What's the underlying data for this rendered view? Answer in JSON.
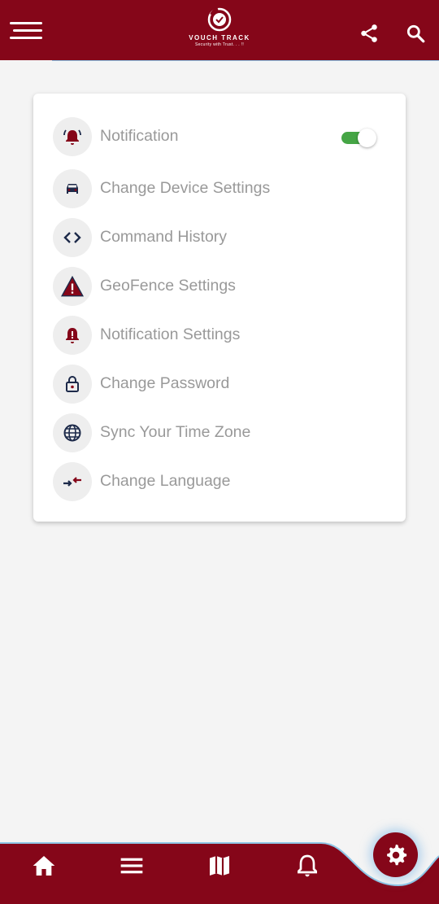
{
  "colors": {
    "brand": "#850619",
    "toggle_on": "#45a545",
    "label": "#999999",
    "icon_dark": "#1d2a4a"
  },
  "header": {
    "logo_title": "VOUCH TRACK",
    "logo_tagline": "Security with Trust. . . !!",
    "icons": [
      "hamburger-menu-icon",
      "share-icon",
      "search-icon"
    ]
  },
  "settings": {
    "items": [
      {
        "label": "Notification",
        "icon": "alarm-bell-icon",
        "toggle": true
      },
      {
        "label": "Change Device Settings",
        "icon": "car-icon"
      },
      {
        "label": "Command History",
        "icon": "code-brackets-icon"
      },
      {
        "label": "GeoFence Settings",
        "icon": "warning-triangle-icon"
      },
      {
        "label": "Notification Settings",
        "icon": "bell-alert-icon"
      },
      {
        "label": "Change Password",
        "icon": "lock-icon"
      },
      {
        "label": "Sync Your Time Zone",
        "icon": "globe-icon"
      },
      {
        "label": "Change Language",
        "icon": "swap-arrows-icon"
      }
    ]
  },
  "bottom_nav": {
    "items": [
      "home-icon",
      "list-icon",
      "map-icon",
      "bell-icon"
    ],
    "active": "settings-gear-icon"
  }
}
